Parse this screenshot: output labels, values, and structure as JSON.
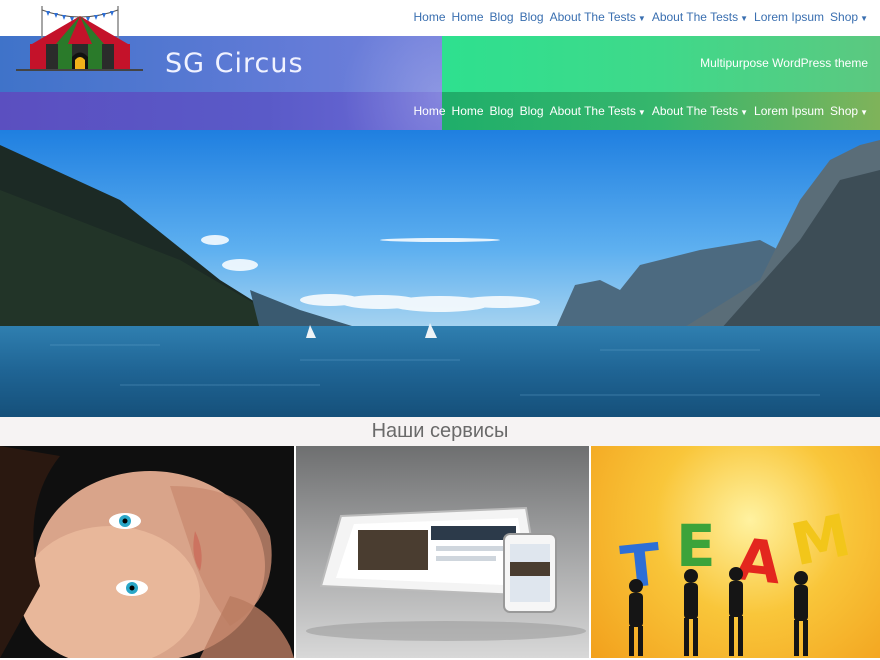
{
  "site": {
    "title": "SG Circus",
    "tagline": "Multipurpose WordPress theme"
  },
  "nav": {
    "items": [
      {
        "label": "Home",
        "dropdown": false
      },
      {
        "label": "Home",
        "dropdown": false
      },
      {
        "label": "Blog",
        "dropdown": false
      },
      {
        "label": "Blog",
        "dropdown": false
      },
      {
        "label": "About The Tests",
        "dropdown": true
      },
      {
        "label": "About The Tests",
        "dropdown": true
      },
      {
        "label": "Lorem Ipsum",
        "dropdown": false
      },
      {
        "label": "Shop",
        "dropdown": true
      }
    ]
  },
  "services": {
    "heading": "Наши сервисы",
    "tiles": [
      {
        "icon": "face-portrait-image"
      },
      {
        "icon": "tablet-phone-image"
      },
      {
        "icon": "team-image",
        "text": "TEAM"
      }
    ]
  },
  "colors": {
    "nav_link": "#3a6fb0",
    "header_left": "#5a71d0",
    "header_right": "#3fd98a"
  }
}
